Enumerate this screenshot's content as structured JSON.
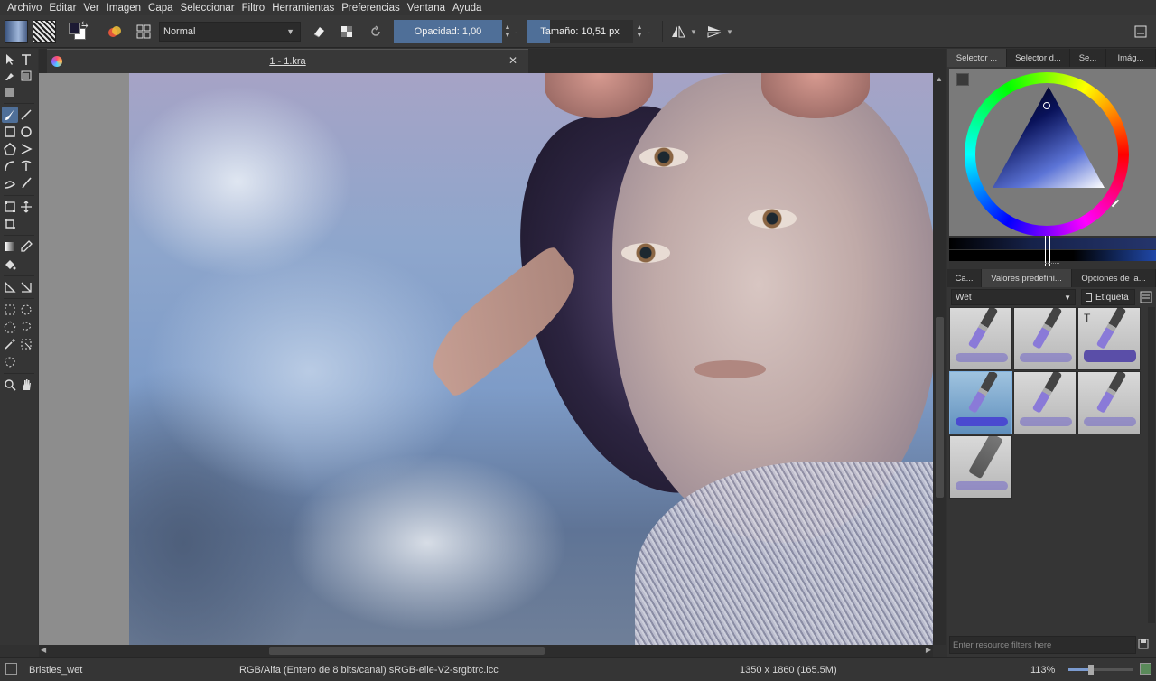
{
  "menubar": {
    "items": [
      "Archivo",
      "Editar",
      "Ver",
      "Imagen",
      "Capa",
      "Seleccionar",
      "Filtro",
      "Herramientas",
      "Preferencias",
      "Ventana",
      "Ayuda"
    ]
  },
  "toolbar": {
    "blend_mode": "Normal",
    "opacity_label": "Opacidad:",
    "opacity_value": "1,00",
    "size_label": "Tamaño:",
    "size_value": "10,51 px"
  },
  "document": {
    "tab_title": "1 - 1.kra"
  },
  "docker": {
    "top_tabs": [
      "Selector ...",
      "Selector d...",
      "Se...",
      "Imág..."
    ],
    "preset_tabs": [
      "Ca...",
      "Valores predefini...",
      "Opciones de la..."
    ],
    "tag_combo": "Wet",
    "tag_button": "Etiqueta",
    "filter_placeholder": "Enter resource filters here"
  },
  "status": {
    "brush": "Bristles_wet",
    "color_model": "RGB/Alfa (Entero de 8 bits/canal)  sRGB-elle-V2-srgbtrc.icc",
    "dimensions": "1350 x 1860 (165.5M)",
    "zoom": "113%"
  },
  "colors": {
    "accent": "#4f6f98",
    "background": "#313131",
    "panel": "#353535",
    "foreground_color": "#1c1a33",
    "background_color": "#ffffff"
  }
}
